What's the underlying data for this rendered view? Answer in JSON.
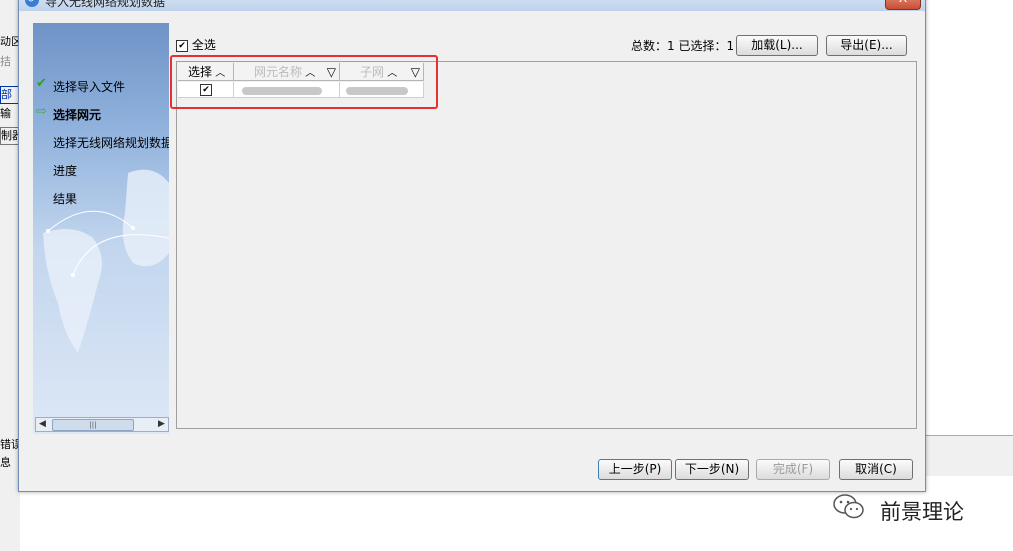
{
  "background": {
    "left_labels": [
      "动区",
      "拮",
      "部",
      "输",
      "制器",
      "错误",
      "息"
    ]
  },
  "dialog": {
    "title": "导入无线网络规划数据",
    "close_label": "X"
  },
  "steps": [
    {
      "label": "选择导入文件",
      "state": "done",
      "icon": "check-icon"
    },
    {
      "label": "选择网元",
      "state": "active",
      "icon": "arrow-right-icon"
    },
    {
      "label": "选择无线网络规划数据",
      "state": "pending",
      "icon": ""
    },
    {
      "label": "进度",
      "state": "pending",
      "icon": ""
    },
    {
      "label": "结果",
      "state": "pending",
      "icon": ""
    }
  ],
  "toolbar": {
    "select_all_label": "全选",
    "select_all_checked": true,
    "totals_text": "总数：1 已选择：1",
    "load_label": "加载(L)...",
    "export_label": "导出(E)..."
  },
  "table": {
    "columns": [
      "选择",
      "网元名称",
      "子网"
    ],
    "rows": [
      {
        "selected": true
      }
    ]
  },
  "footer": {
    "prev_label": "上一步(P)",
    "next_label": "下一步(N)",
    "finish_label": "完成(F)",
    "cancel_label": "取消(C)"
  },
  "watermark": {
    "text": "前景理论"
  },
  "colors": {
    "accent": "#6f93c7",
    "highlight_border": "#e53030",
    "step_check": "#2ea02e",
    "step_arrow": "#45b02a"
  }
}
